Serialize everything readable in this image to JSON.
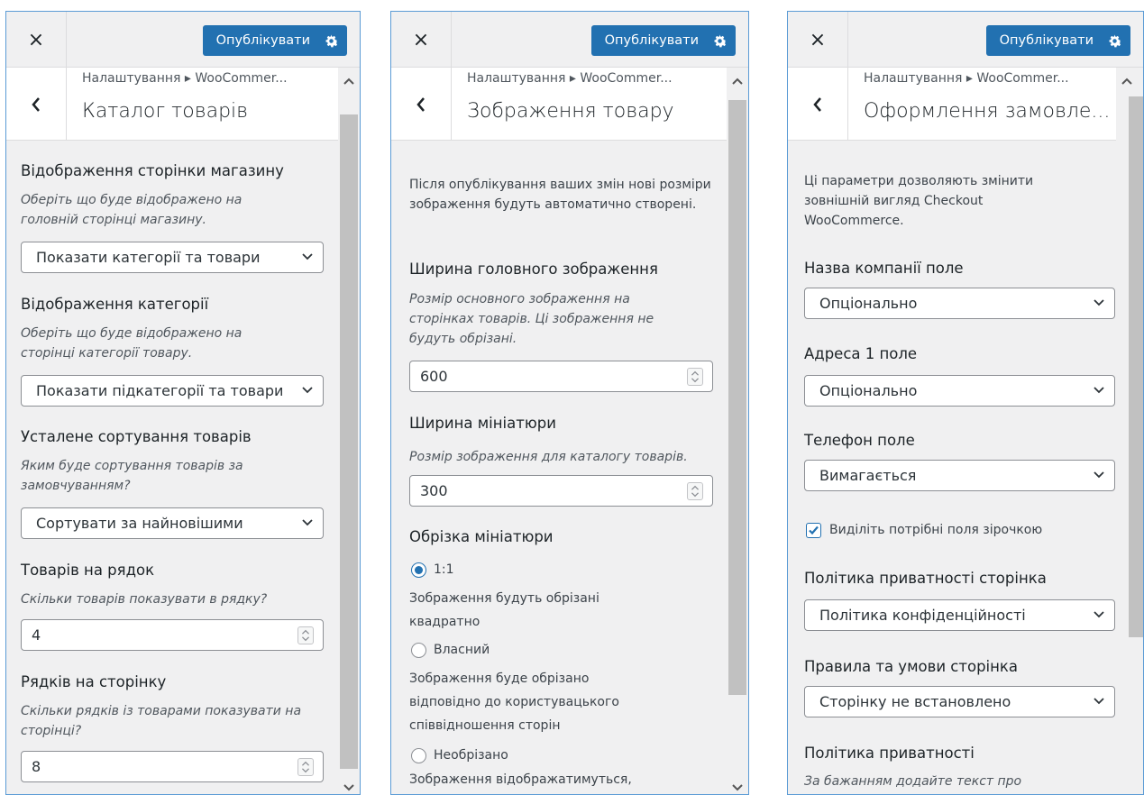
{
  "panels": [
    {
      "close": "×",
      "publish": "Опублікувати",
      "breadcrumb": "Налаштування ▸ WooCommer...",
      "title": "Каталог товарів",
      "shop_display": {
        "heading": "Відображення сторінки магазину",
        "desc": "Оберіть що буде відображено на головній сторінці магазину.",
        "value": "Показати категорії та товари"
      },
      "category_display": {
        "heading": "Відображення категорії",
        "desc": "Оберіть що буде відображено на сторінці категорії товару.",
        "value": "Показати підкатегорії та товари"
      },
      "default_sorting": {
        "heading": "Усталене сортування товарів",
        "desc": "Яким буде сортування товарів за замовчуванням?",
        "value": "Сортувати за найновішими"
      },
      "products_per_row": {
        "heading": "Товарів на рядок",
        "desc": "Скільки товарів показувати в рядку?",
        "value": "4"
      },
      "rows_per_page": {
        "heading": "Рядків на сторінку",
        "desc": "Скільки рядків із товарами показувати на сторінці?",
        "value": "8"
      }
    },
    {
      "close": "×",
      "publish": "Опублікувати",
      "breadcrumb": "Налаштування ▸ WooCommer...",
      "title": "Зображення товару",
      "intro": "Після опублікування ваших змін нові розміри зображення будуть автоматично створені.",
      "main_width": {
        "heading": "Ширина головного зображення",
        "desc": "Розмір основного зображення на сторінках товарів. Ці зображення не будуть обрізані.",
        "value": "600"
      },
      "thumb_width": {
        "heading": "Ширина мініатюри",
        "desc": "Розмір зображення для каталогу товарів.",
        "value": "300"
      },
      "cropping": {
        "heading": "Обрізка мініатюри",
        "options": [
          {
            "label": "1:1",
            "desc": "Зображення будуть обрізані квадратно",
            "selected": true
          },
          {
            "label": "Власний",
            "desc": "Зображення буде обрізано відповідно до користувацького співвідношення сторін",
            "selected": false
          },
          {
            "label": "Необрізано",
            "desc": "Зображення відображатимуться,",
            "selected": false
          }
        ]
      }
    },
    {
      "close": "×",
      "publish": "Опублікувати",
      "breadcrumb": "Налаштування ▸ WooCommer...",
      "title": "Оформлення замовле...",
      "intro": "Ці параметри дозволяють змінити зовнішній вигляд Checkout WooCommerce.",
      "company_field": {
        "heading": "Назва компанії поле",
        "value": "Опціонально"
      },
      "address1_field": {
        "heading": "Адреса 1 поле",
        "value": "Опціонально"
      },
      "phone_field": {
        "heading": "Телефон поле",
        "value": "Вимагається"
      },
      "highlight_required": {
        "label": "Виділіть потрібні поля зірочкою",
        "checked": true
      },
      "privacy_page": {
        "heading": "Політика приватності сторінка",
        "value": "Політика конфіденційності"
      },
      "terms_page": {
        "heading": "Правила та умови сторінка",
        "value": "Сторінку не встановлено"
      },
      "privacy_policy": {
        "heading": "Політика приватності",
        "desc": "За бажанням додайте текст про"
      }
    }
  ],
  "colors": {
    "accent": "#2271b1",
    "border": "#8c8f94",
    "panel_bg": "#f0f0f1"
  },
  "icons": {
    "close": "close-icon",
    "gear": "gear-icon",
    "back": "chevron-left-icon",
    "select": "chevron-down-icon",
    "spinner": "spinner-arrows-icon"
  }
}
